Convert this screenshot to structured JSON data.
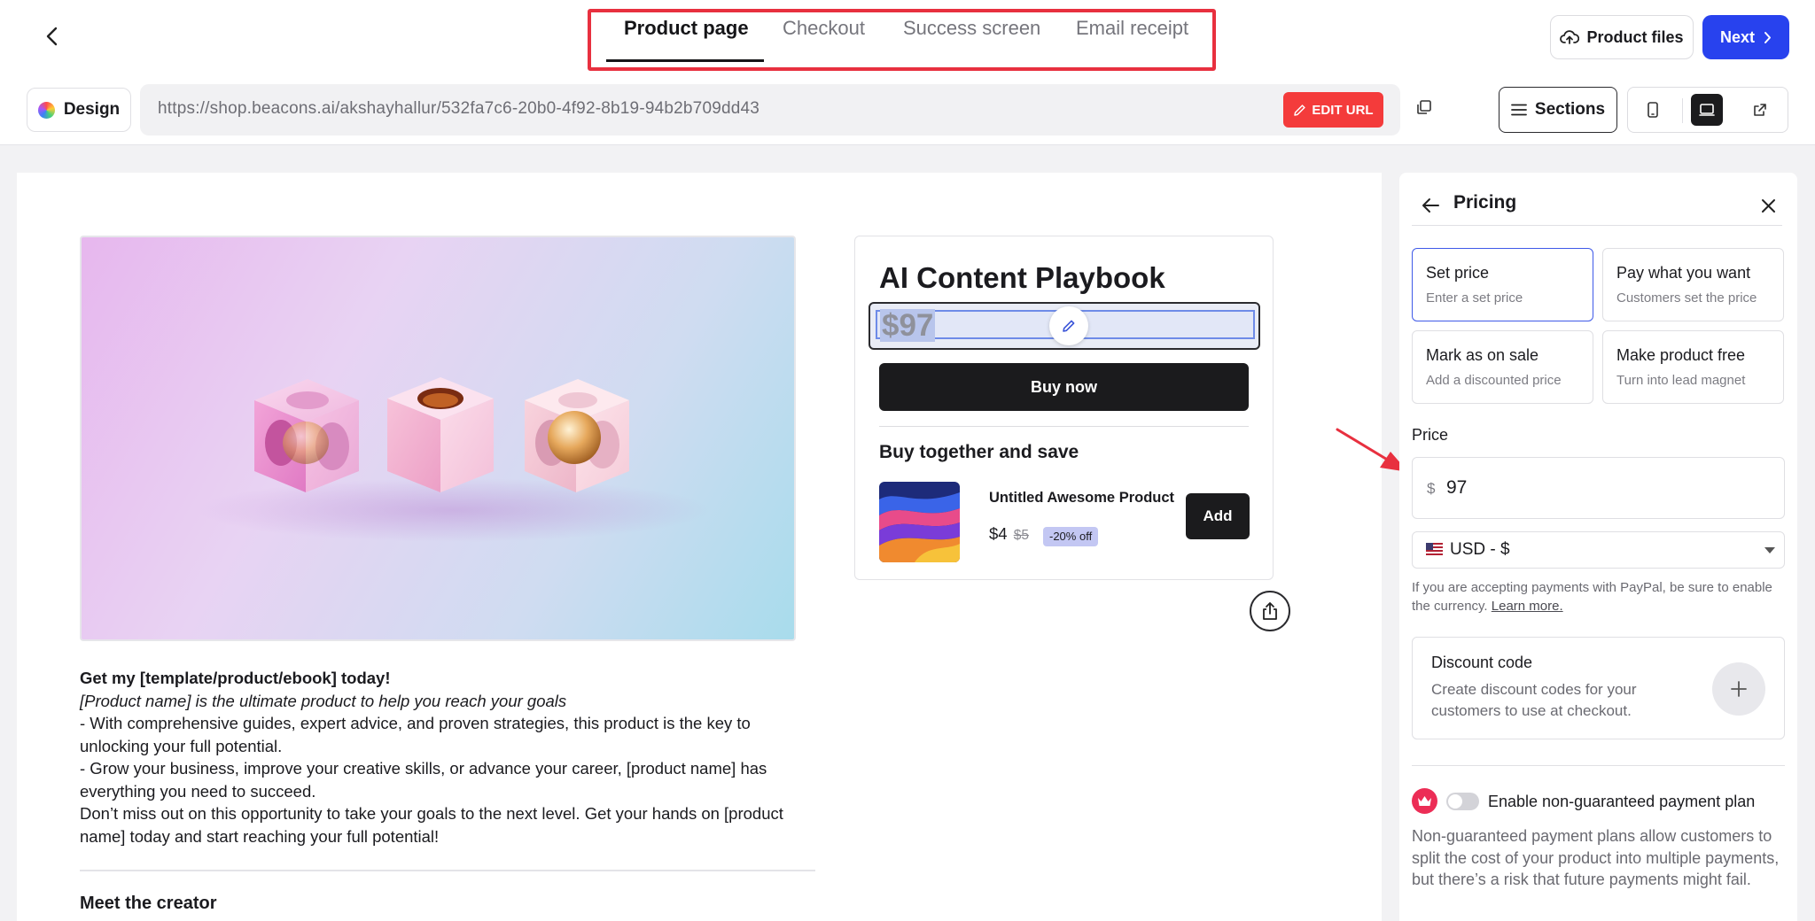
{
  "header": {
    "tabs": [
      {
        "label": "Product page",
        "active": true
      },
      {
        "label": "Checkout",
        "active": false
      },
      {
        "label": "Success screen",
        "active": false
      },
      {
        "label": "Email receipt",
        "active": false
      }
    ],
    "product_files_label": "Product files",
    "next_label": "Next"
  },
  "toolbar": {
    "design_label": "Design",
    "url": "https://shop.beacons.ai/akshayhallur/532fa7c6-20b0-4f92-8b19-94b2b709dd43",
    "edit_url_label": "EDIT URL",
    "sections_label": "Sections",
    "active_device": "desktop"
  },
  "product": {
    "description": {
      "headline": "Get my [template/product/ebook] today!",
      "tagline": "[Product name] is the ultimate product to help you reach your goals",
      "bullet1": "- With comprehensive guides, expert advice, and proven strategies, this product is the key to unlocking your full potential.",
      "bullet2": "- Grow your business, improve your creative skills, or advance your career, [product name] has everything you need to succeed.",
      "closing": "Don’t miss out on this opportunity to take your goals to the next level. Get your hands on [product name] today and start reaching your full potential!"
    },
    "meet_creator": "Meet the creator",
    "card": {
      "title": "AI Content Playbook",
      "price": "$97",
      "buy_label": "Buy now",
      "bundle_title": "Buy together and save",
      "bundle_item": {
        "name": "Untitled Awesome Product",
        "price": "$4",
        "old_price": "$5",
        "discount": "-20% off",
        "add_label": "Add"
      }
    }
  },
  "pricing_panel": {
    "title": "Pricing",
    "options": [
      {
        "title": "Set price",
        "subtitle": "Enter a set price",
        "selected": true
      },
      {
        "title": "Pay what you want",
        "subtitle": "Customers set the price",
        "selected": false
      },
      {
        "title": "Mark as on sale",
        "subtitle": "Add a discounted price",
        "selected": false
      },
      {
        "title": "Make product free",
        "subtitle": "Turn into lead magnet",
        "selected": false
      }
    ],
    "price_label": "Price",
    "currency_symbol": "$",
    "price_value": "97",
    "currency": "USD - $",
    "paypal_note": "If you are accepting payments with PayPal, be sure to enable the currency.",
    "learn_more": "Learn more.",
    "discount": {
      "title": "Discount code",
      "subtitle": "Create discount codes for your customers to use at checkout."
    },
    "payment_plan": {
      "label": "Enable non-guaranteed payment plan",
      "enabled": false,
      "note": "Non-guaranteed payment plans allow customers to split the cost of your product into multiple payments, but there’s a risk that future payments might fail."
    }
  },
  "colors": {
    "accent_blue": "#2842ee",
    "edit_url_red": "#f43b3b",
    "highlight_red": "#e8303f",
    "crown_pink": "#ec2d56",
    "annotation_arrow": "#e8303f"
  },
  "icons": [
    "chevron-left-icon",
    "cloud-upload-icon",
    "chevron-right-icon",
    "color-wheel-icon",
    "pencil-icon",
    "copy-icon",
    "menu-icon",
    "phone-icon",
    "laptop-icon",
    "external-link-icon",
    "share-icon",
    "arrow-left-icon",
    "close-icon",
    "plus-icon",
    "crown-icon",
    "us-flag-icon"
  ]
}
